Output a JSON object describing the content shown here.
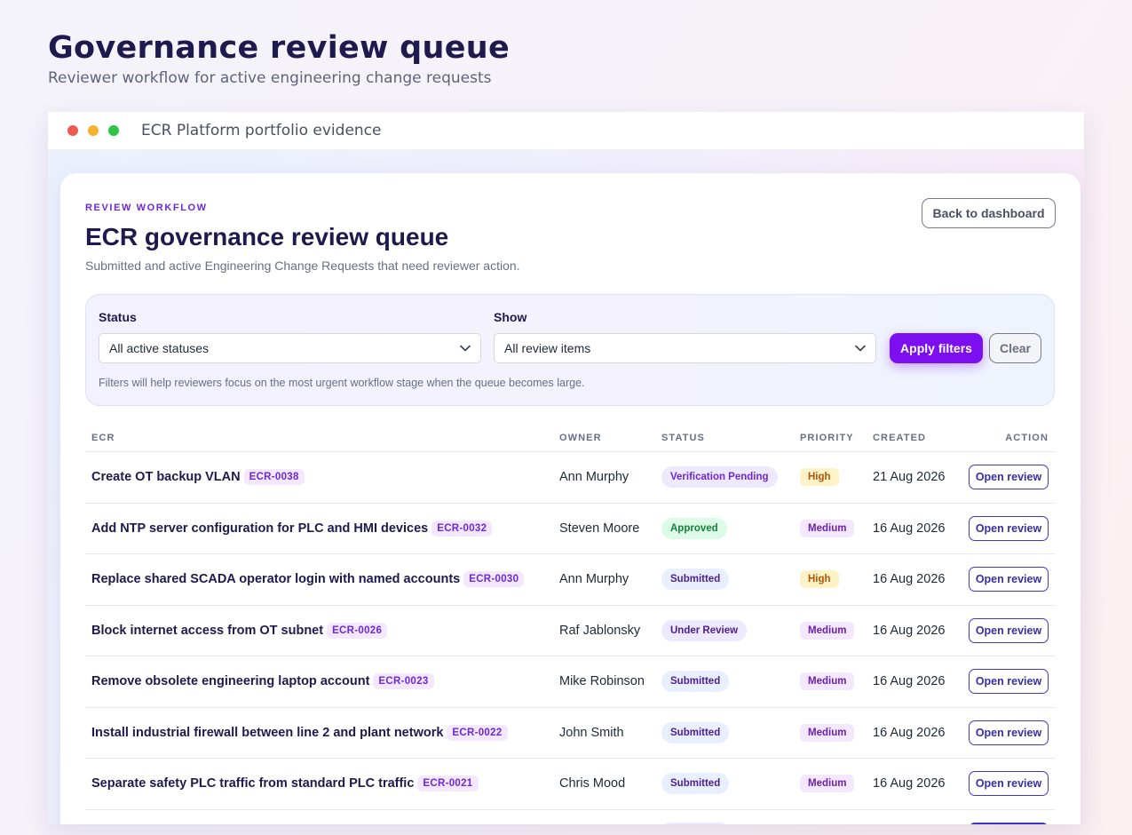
{
  "page": {
    "title": "Governance review queue",
    "subtitle": "Reviewer workflow for active engineering change requests"
  },
  "window": {
    "title": "ECR Platform portfolio evidence"
  },
  "card": {
    "eyebrow": "REVIEW WORKFLOW",
    "title": "ECR governance review queue",
    "description": "Submitted and active Engineering Change Requests that need reviewer action.",
    "back_label": "Back to dashboard"
  },
  "filters": {
    "status_label": "Status",
    "status_value": "All active statuses",
    "show_label": "Show",
    "show_value": "All review items",
    "apply_label": "Apply filters",
    "clear_label": "Clear",
    "hint": "Filters will help reviewers focus on the most urgent workflow stage when the queue becomes large."
  },
  "table": {
    "columns": {
      "ecr": "ECR",
      "owner": "OWNER",
      "status": "STATUS",
      "priority": "PRIORITY",
      "created": "CREATED",
      "action": "ACTION"
    },
    "rows": [
      {
        "title": "Create OT backup VLAN",
        "code": "ECR-0038",
        "owner": "Ann Murphy",
        "status": "Verification Pending",
        "priority": "High",
        "created": "21 Aug 2026",
        "action": "Open review"
      },
      {
        "title": "Add NTP server configuration for PLC and HMI devices",
        "code": "ECR-0032",
        "owner": "Steven Moore",
        "status": "Approved",
        "priority": "Medium",
        "created": "16 Aug 2026",
        "action": "Open review"
      },
      {
        "title": "Replace shared SCADA operator login with named accounts",
        "code": "ECR-0030",
        "owner": "Ann Murphy",
        "status": "Submitted",
        "priority": "High",
        "created": "16 Aug 2026",
        "action": "Open review"
      },
      {
        "title": "Block internet access from OT subnet",
        "code": "ECR-0026",
        "owner": "Raf Jablonsky",
        "status": "Under Review",
        "priority": "Medium",
        "created": "16 Aug 2026",
        "action": "Open review"
      },
      {
        "title": "Remove obsolete engineering laptop account",
        "code": "ECR-0023",
        "owner": "Mike Robinson",
        "status": "Submitted",
        "priority": "Medium",
        "created": "16 Aug 2026",
        "action": "Open review"
      },
      {
        "title": "Install industrial firewall between line 2 and plant network",
        "code": "ECR-0022",
        "owner": "John Smith",
        "status": "Submitted",
        "priority": "Medium",
        "created": "16 Aug 2026",
        "action": "Open review"
      },
      {
        "title": "Separate safety PLC traffic from standard PLC traffic",
        "code": "ECR-0021",
        "owner": "Chris Mood",
        "status": "Submitted",
        "priority": "Medium",
        "created": "16 Aug 2026",
        "action": "Open review"
      }
    ]
  },
  "colors": {
    "accent": "#7c0ff0",
    "status": {
      "Verification Pending": {
        "bg": "#ede9fe",
        "fg": "#6d28d9"
      },
      "Approved": {
        "bg": "#dcfce7",
        "fg": "#15803d"
      },
      "Submitted": {
        "bg": "#e8f0ff",
        "fg": "#4c1d95"
      },
      "Under Review": {
        "bg": "#ede9fe",
        "fg": "#4c1d95"
      }
    },
    "priority": {
      "High": {
        "bg": "#fef3c7",
        "fg": "#b45309"
      },
      "Medium": {
        "bg": "#f3e8ff",
        "fg": "#6b21a8"
      }
    }
  },
  "icons": {
    "select_chevron": "chevron-down-icon"
  }
}
